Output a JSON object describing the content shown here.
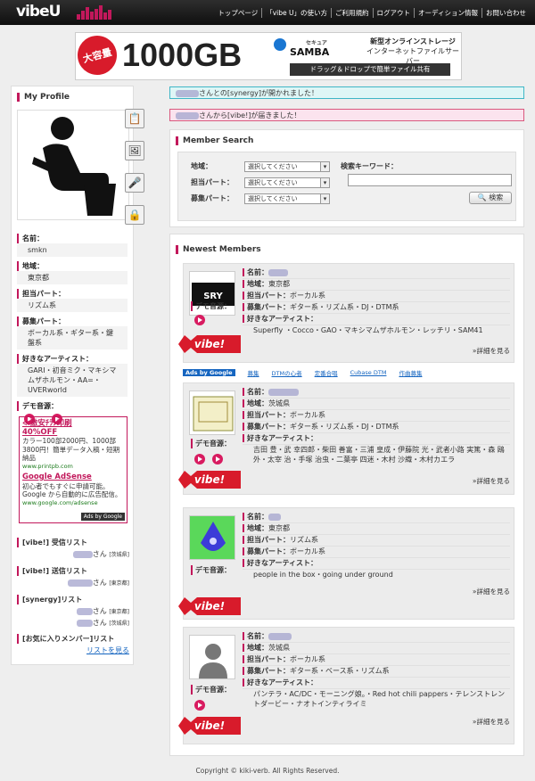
{
  "header": {
    "logo": "vibeU",
    "nav": [
      "トップページ",
      "「vibe U」の使い方",
      "ご利用規約",
      "ログアウト",
      "オーディション情報",
      "お問い合わせ"
    ]
  },
  "banner": {
    "badge": "大容量",
    "size": "1000GB",
    "brand": "SAMBA",
    "brand_sub": "セキュア",
    "line1": "新型オンラインストレージ",
    "line2": "インターネットファイルサーバー",
    "strip": "ドラッグ＆ドロップで簡単ファイル共有"
  },
  "notices": {
    "n1": "さんとの[synergy]が開かれました！",
    "n2": "さんから[vibe!]が届きました！"
  },
  "profile": {
    "title": "My Profile",
    "name_label": "名前：",
    "name": "smkn",
    "area_label": "地域：",
    "area": "東京都",
    "part_label": "担当パート：",
    "part": "リズム系",
    "wanted_label": "募集パート：",
    "wanted": "ボーカル系・ギター系・鍵盤系",
    "artists_label": "好きなアーティスト：",
    "artists": "GARI・初音ミク・マキシマムザホルモン・AA=・UVERworld",
    "demo_label": "デモ音源："
  },
  "adsense": {
    "title": "≪激安ﾁﾗｼ印刷\n40%OFF",
    "body": "カラー100部2000円、1000部3800円！簡単データ入稿・短期納品",
    "url": "www.printpb.com",
    "title2": "Google AdSense",
    "body2": "初心者でもすぐに申請可能。Google から自動的に広告配信。",
    "url2": "www.google.com/adsense",
    "foot": "Ads by Google"
  },
  "lists": {
    "recv": "[vibe!] 受信リスト",
    "sent": "[vibe!] 送信リスト",
    "synergy": "[synergy]リスト",
    "fav": "[お気に入りメンバー]リスト",
    "fav_link": "リストを見る",
    "san": "さん",
    "tag_ibaraki": "[茨城県]",
    "tag_tokyo": "[東京都]"
  },
  "search": {
    "title": "Member Search",
    "area_label": "地域：",
    "part_label": "担当パート：",
    "wanted_label": "募集パート：",
    "select_default": "選択してください",
    "kw_label": "検索キーワード：",
    "button": "検索"
  },
  "members": {
    "title": "Newest Members",
    "name_label": "名前：",
    "area_label": "地域：",
    "part_label": "担当パート：",
    "wanted_label": "募集パート：",
    "artists_label": "好きなアーティスト：",
    "demo_label": "デモ音源：",
    "vibe": "vibe!",
    "detail": "»詳細を見る",
    "list": [
      {
        "area": "東京都",
        "part": "ボーカル系",
        "wanted": "ギター系・リズム系・DJ・DTM系",
        "artists": "Superfly ・Cocco・GAO・マキシマムザホルモン・レッチリ・SAM41"
      },
      {
        "area": "茨城県",
        "part": "ボーカル系",
        "wanted": "ギター系・リズム系・DJ・DTM系",
        "artists": "吉田 豊・武 幸四郎・柴田 善富・三浦 皇成・伊藤院 光・武者小路 実篤・森 鴎外・太宰 治・手塚 治虫・二葉亭 四迷・木村 沙織・木村カエラ"
      },
      {
        "area": "東京都",
        "part": "リズム系",
        "wanted": "ボーカル系",
        "artists": "people in the box・going under ground"
      },
      {
        "area": "茨城県",
        "part": "ボーカル系",
        "wanted": "ギター系・ベース系・リズム系",
        "artists": "パンテラ・AC/DC・モーニング娘。・Red hot chili pappers・テレンストレントダービー・ナオトインティライミ"
      }
    ]
  },
  "adlinks": {
    "badge": "Ads by Google",
    "links": [
      "募集",
      "DTMの心者",
      "定番合唱",
      "Cubase DTM",
      "作曲募集"
    ]
  },
  "footer": "Copyright © kiki-verb. All Rights Reserved."
}
